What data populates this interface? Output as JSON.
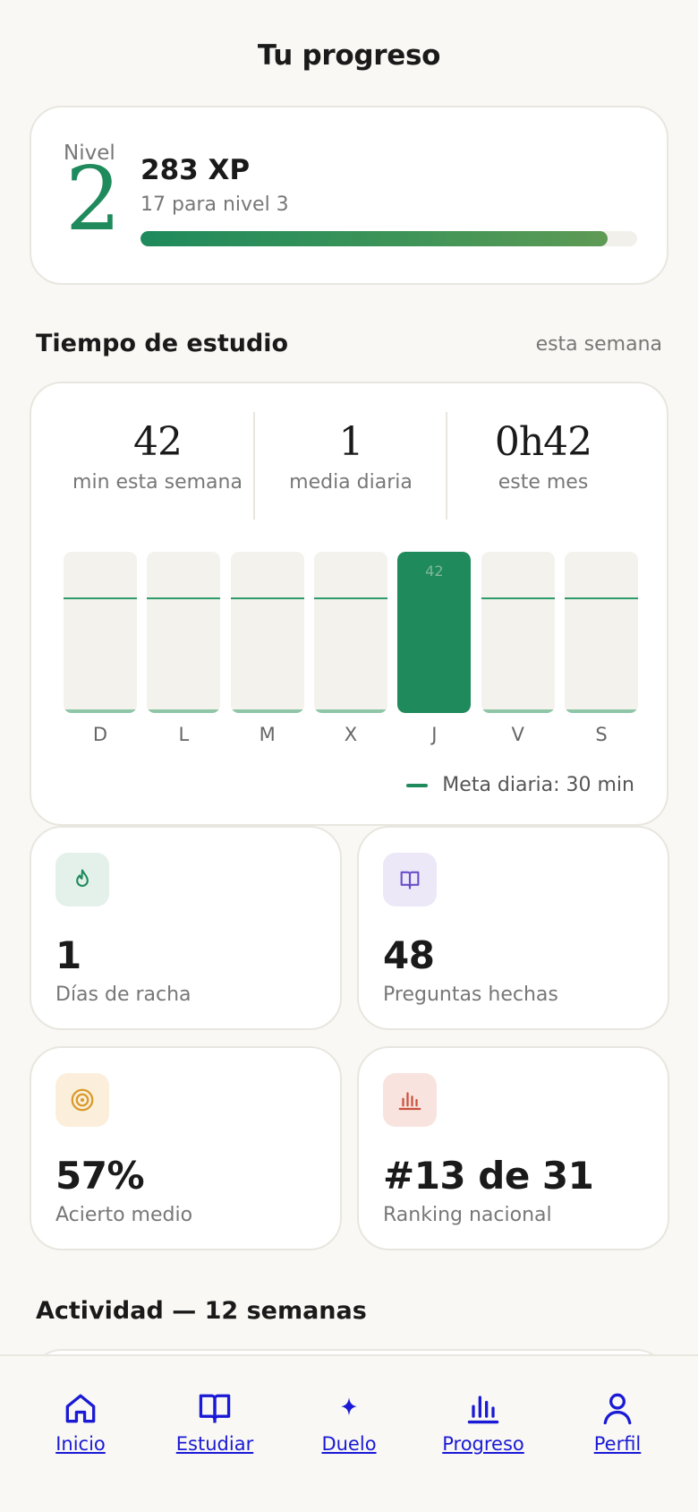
{
  "header": {
    "title": "Tu progreso"
  },
  "level": {
    "label": "Nivel",
    "number": "2",
    "xp": "283 XP",
    "next": "17 para nivel 3",
    "progress": 0.94
  },
  "study": {
    "title": "Tiempo de estudio",
    "period": "esta semana",
    "stats": [
      {
        "value": "42",
        "label": "min esta semana"
      },
      {
        "value": "1",
        "label": "media diaria"
      },
      {
        "value": "0h42",
        "label": "este mes"
      }
    ],
    "goal_label": "Meta diaria: 30 min"
  },
  "chart_data": {
    "type": "bar",
    "categories": [
      "D",
      "L",
      "M",
      "X",
      "J",
      "V",
      "S"
    ],
    "values": [
      0,
      0,
      0,
      0,
      42,
      0,
      0
    ],
    "value_labels": [
      "",
      "",
      "",
      "",
      "42",
      "",
      ""
    ],
    "goal": 30,
    "ylim": [
      0,
      42
    ],
    "legend": "Meta diaria: 30 min"
  },
  "tiles": [
    {
      "icon": "flame-icon",
      "value": "1",
      "label": "Días de racha",
      "icon_bg": "#e3f1ea",
      "icon_color": "#1f8a5c"
    },
    {
      "icon": "book-icon",
      "value": "48",
      "label": "Preguntas hechas",
      "icon_bg": "#ece8f8",
      "icon_color": "#6a4fc9"
    },
    {
      "icon": "target-icon",
      "value": "57%",
      "label": "Acierto medio",
      "icon_bg": "#fbefdc",
      "icon_color": "#d99a2b"
    },
    {
      "icon": "ranking-icon",
      "value": "#13 de 31",
      "label": "Ranking nacional",
      "icon_bg": "#f9e3de",
      "icon_color": "#c9523e"
    }
  ],
  "activity": {
    "title": "Actividad — 12 semanas"
  },
  "nav": [
    {
      "icon": "home-icon",
      "label": "Inicio"
    },
    {
      "icon": "book-icon",
      "label": "Estudiar"
    },
    {
      "icon": "sparkle-icon",
      "label": "Duelo"
    },
    {
      "icon": "bar-chart-icon",
      "label": "Progreso"
    },
    {
      "icon": "user-icon",
      "label": "Perfil"
    }
  ],
  "colors": {
    "accent": "#1f8a5c",
    "link": "#1a1ad6",
    "background": "#f9f8f4"
  }
}
